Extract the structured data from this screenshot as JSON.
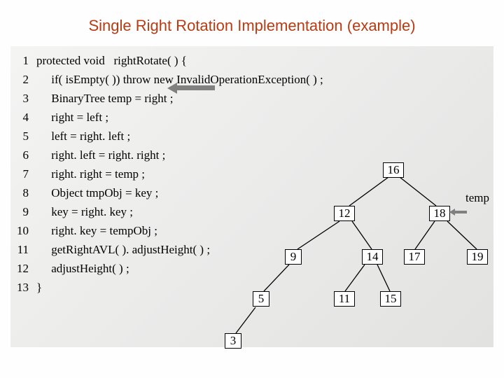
{
  "title": "Single Right Rotation Implementation (example)",
  "code": {
    "lines": [
      {
        "n": "1",
        "t": "protected void   rightRotate( ) {"
      },
      {
        "n": "2",
        "t": "     if( isEmpty( )) throw new InvalidOperationException( ) ;"
      },
      {
        "n": "3",
        "t": "     BinaryTree temp = right ;"
      },
      {
        "n": "4",
        "t": "     right = left ;"
      },
      {
        "n": "5",
        "t": "     left = right. left ;"
      },
      {
        "n": "6",
        "t": "     right. left = right. right ;"
      },
      {
        "n": "7",
        "t": "     right. right = temp ;"
      },
      {
        "n": "8",
        "t": "     Object tmpObj = key ;"
      },
      {
        "n": "9",
        "t": "     key = right. key ;"
      },
      {
        "n": "10",
        "t": "     right. key = tempObj ;"
      },
      {
        "n": "11",
        "t": "     getRightAVL( ). adjustHeight( ) ;"
      },
      {
        "n": "12",
        "t": "     adjustHeight( ) ;"
      },
      {
        "n": "13",
        "t": "}"
      }
    ]
  },
  "tree": {
    "temp_label": "temp",
    "nodes": {
      "n16": "16",
      "n12": "12",
      "n18": "18",
      "n9": "9",
      "n14": "14",
      "n17": "17",
      "n19": "19",
      "n5": "5",
      "n11": "11",
      "n15": "15",
      "n3": "3"
    }
  }
}
